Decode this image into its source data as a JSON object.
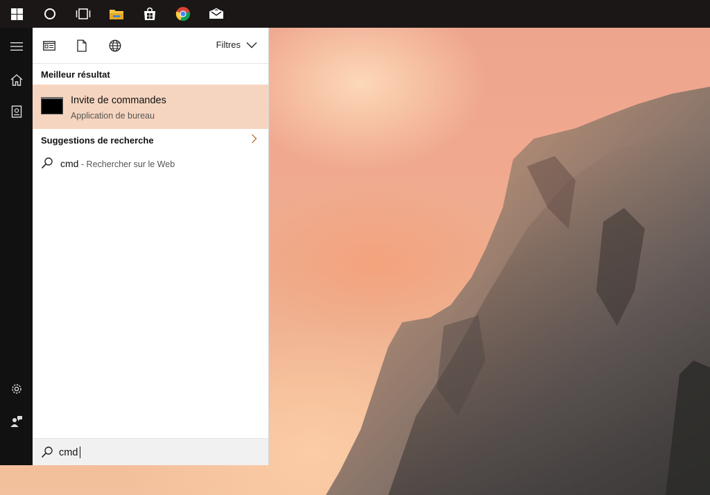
{
  "taskbar": {
    "items": [
      {
        "icon": "windows-logo-icon"
      },
      {
        "icon": "cortana-circle-icon"
      },
      {
        "icon": "task-view-icon"
      },
      {
        "icon": "file-explorer-icon"
      },
      {
        "icon": "store-icon"
      },
      {
        "icon": "chrome-icon"
      },
      {
        "icon": "mail-icon"
      }
    ]
  },
  "rail": {
    "items": [
      {
        "icon": "hamburger-menu-icon"
      },
      {
        "icon": "home-icon"
      },
      {
        "icon": "notebook-icon"
      },
      {
        "icon": "settings-gear-icon"
      },
      {
        "icon": "feedback-icon"
      }
    ]
  },
  "search_panel": {
    "filters_label": "Filtres",
    "best_result_heading": "Meilleur résultat",
    "best_result": {
      "title": "Invite de commandes",
      "subtitle": "Application de bureau"
    },
    "suggestions_heading": "Suggestions de recherche",
    "suggestions": [
      {
        "query": "cmd",
        "suffix": " - Rechercher sur le Web"
      }
    ],
    "search_box": {
      "value": "cmd"
    }
  },
  "colors": {
    "taskbar_bg": "#1b1716",
    "rail_bg": "#111111",
    "highlight_bg": "#f6d5c0",
    "chevron_accent": "#c0753a"
  }
}
